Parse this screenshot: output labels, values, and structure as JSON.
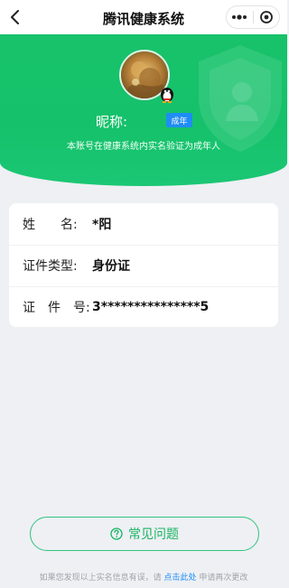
{
  "navbar": {
    "title": "腾讯健康系统",
    "back_icon": "chevron-left-icon",
    "more_icon": "more-dots-icon",
    "close_icon": "target-close-icon"
  },
  "profile": {
    "nickname_label": "昵称:",
    "age_badge": "成年",
    "verify_note": "本账号在健康系统内实名验证为成年人"
  },
  "info": {
    "rows": [
      {
        "label": "姓　　名:",
        "value": "*阳"
      },
      {
        "label": "证件类型:",
        "value": "身份证"
      },
      {
        "label": "证　件　号:",
        "value": "3***************5"
      }
    ]
  },
  "faq": {
    "label": "常见问题",
    "icon": "question-circle-icon"
  },
  "footer": {
    "text_before": "如果您发现以上实名信息有误，请",
    "link": "点击此处",
    "text_after": "申请再次更改"
  },
  "colors": {
    "brand_green": "#17c26a",
    "badge_blue": "#1f8df5",
    "background": "#eef0f4"
  }
}
